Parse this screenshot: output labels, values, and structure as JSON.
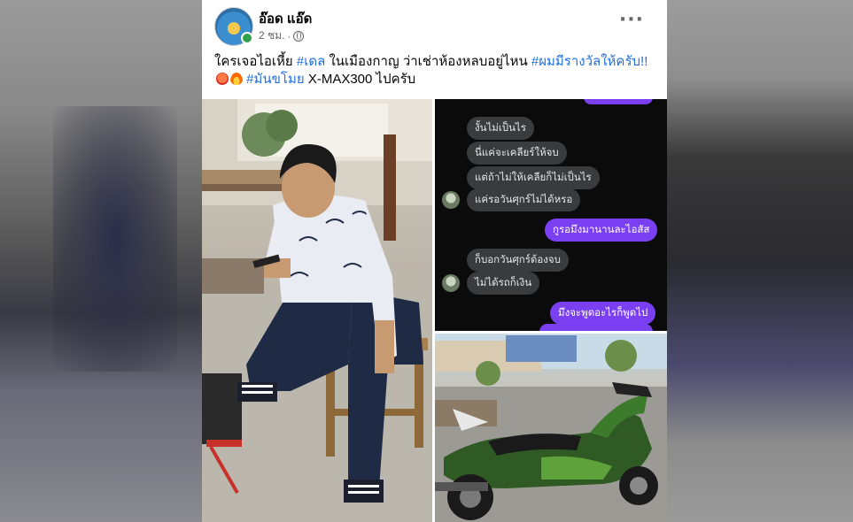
{
  "post": {
    "author": "อ๊อด แอ๊ด",
    "time": "2 ชม.",
    "privacy_icon": "globe-icon",
    "more_icon": "more-options-icon",
    "text_1": "ใครเจอไอเหี้ย ",
    "hashtag_1": "#เดล",
    "text_2": " ในเมืองกาญ ว่าเช่าห้องหลบอยู่ไหน ",
    "hashtag_2": "#ผมมีรางวัลให้ครับ!!",
    "hashtag_3": "#มันขโมย",
    "text_3": " X-MAX300 ไปครับ"
  },
  "chat": {
    "messages": [
      {
        "text": "งั้นไม่เป็นไร",
        "from": "other"
      },
      {
        "text": "นี่แค่จะเคลียร์ให้จบ",
        "from": "other"
      },
      {
        "text": "แต่ถ้าไม่ให้เคลียก็ไม่เป็นไร",
        "from": "other"
      },
      {
        "text": "แค่รอวันศุกร์ไม่ได้หรอ",
        "from": "other"
      },
      {
        "text": "กูรอมึงมานานละไอสัส",
        "from": "me"
      },
      {
        "text": "ก็บอกวันศุกร์ต้องจบ",
        "from": "other"
      },
      {
        "text": "ไม่ได้รถก็เงิน",
        "from": "other"
      },
      {
        "text": "มึงจะพูดอะไรก็พูดไป",
        "from": "me"
      }
    ]
  },
  "colors": {
    "hashtag": "#216fdb",
    "my_bubble": "#7b3ff2",
    "their_bubble": "#3a3b3c",
    "online": "#31a24c"
  }
}
